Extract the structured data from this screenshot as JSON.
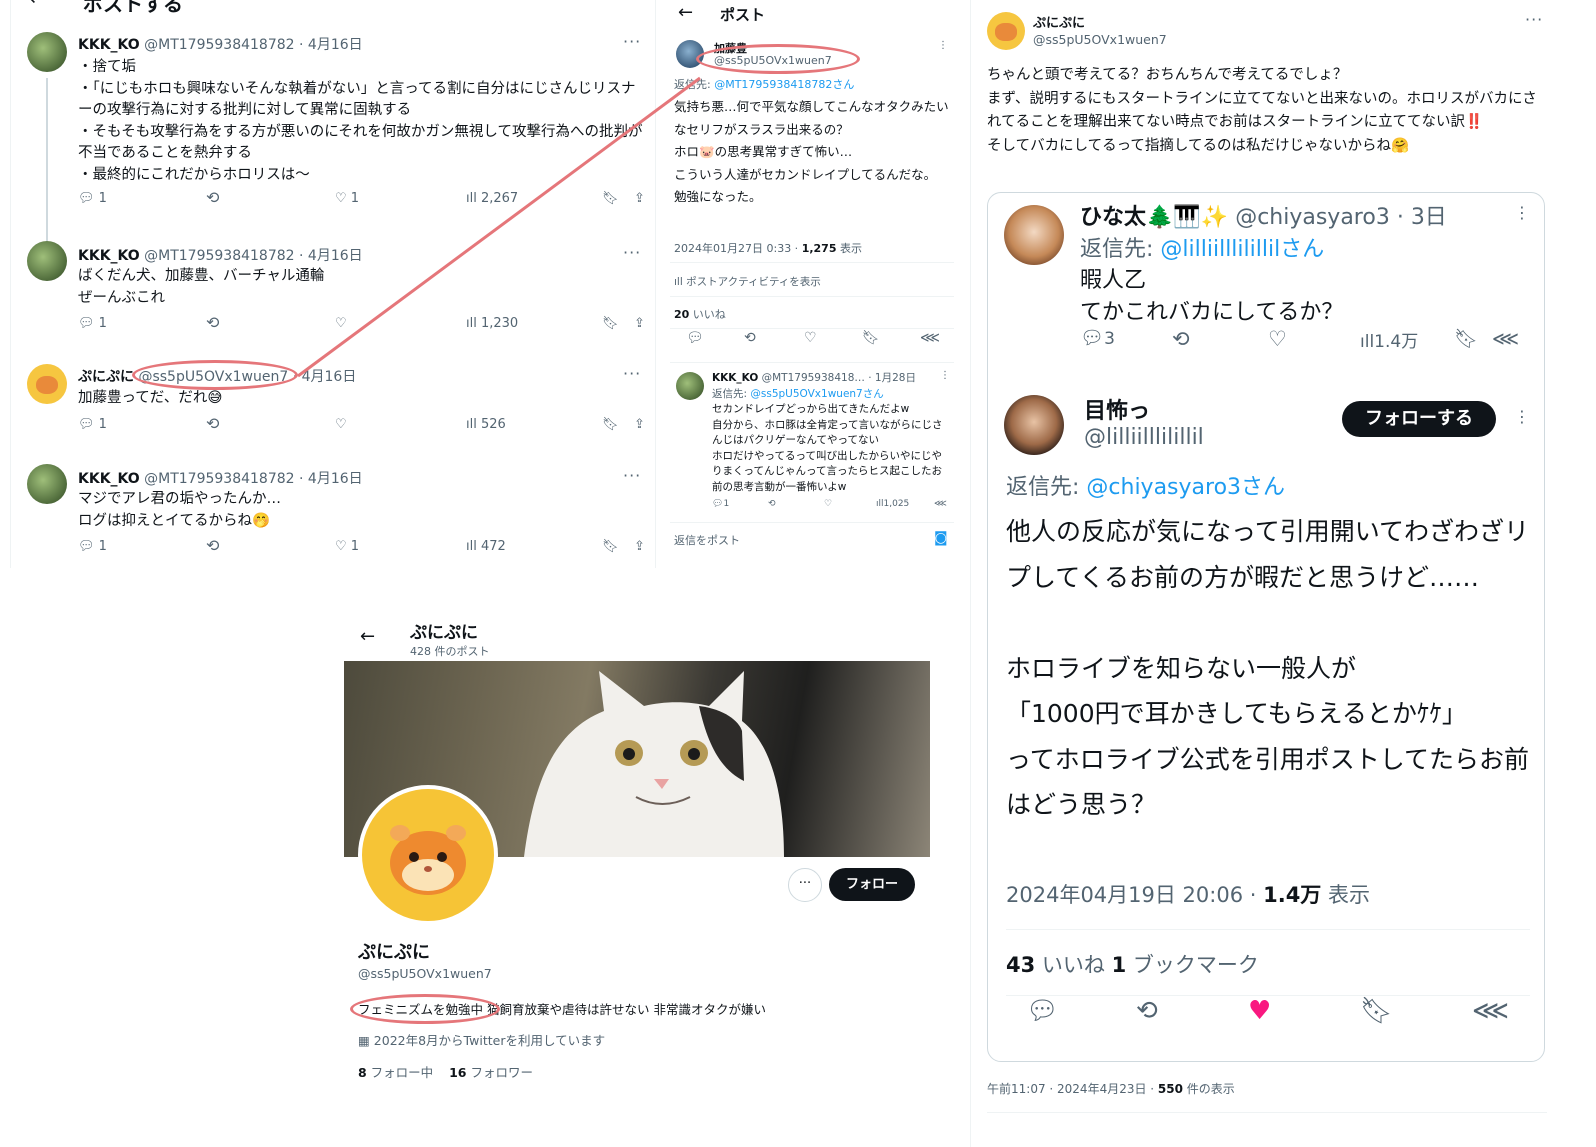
{
  "panel1": {
    "header_title": "ポストする",
    "posts": [
      {
        "name": "KKK_KO",
        "handle": "@MT1795938418782",
        "date": "· 4月16日",
        "text": "・捨て垢\n・「にじもホロも興味ないそんな執着がない」と言ってる割に自分はにじさんじリスナーの攻撃行為に対する批判に対して異常に固執する\n・そもそも攻撃行為をする方が悪いのにそれを何故かガン無視して攻撃行為への批判が不当であることを熱弁する\n・最終的にこれだからホロリスは～",
        "replies": "1",
        "retweets": "",
        "likes": "1",
        "views": "2,267"
      },
      {
        "name": "KKK_KO",
        "handle": "@MT1795938418782",
        "date": "· 4月16日",
        "text": "ばくだん犬、加藤豊、バーチャル通輪\nぜーんぶこれ",
        "replies": "1",
        "retweets": "",
        "likes": "",
        "views": "1,230"
      },
      {
        "name": "ぷにぷに",
        "handle": "@ss5pU5OVx1wuen7",
        "date": "· 4月16日",
        "text": "加藤豊ってだ、だれ😅",
        "replies": "1",
        "retweets": "",
        "likes": "",
        "views": "526"
      },
      {
        "name": "KKK_KO",
        "handle": "@MT1795938418782",
        "date": "· 4月16日",
        "text": "マジでアレ君の垢やったんか…\nログは抑えとイてるからね🤭",
        "replies": "1",
        "retweets": "",
        "likes": "1",
        "views": "472"
      }
    ]
  },
  "panel2": {
    "header_title": "ポスト",
    "author_name": "加藤豊",
    "author_handle": "@ss5pU5OVx1wuen7",
    "reply_to_prefix": "返信先: ",
    "reply_to_handle": "@MT1795938418782さん",
    "text": "気持ち悪…何で平気な顔してこんなオタクみたいなセリフがスラスラ出来るの？\nホロ🐷の思考異常すぎて怖い…\nこういう人達がセカンドレイプしてるんだな。\n勉強になった。",
    "timestamp": "2024年01月27日 0:33 · ",
    "views_count": "1,275",
    "views_label": " 表示",
    "activity": "ポストアクティビティを表示",
    "likes_count": "20",
    "likes_label": " いいね",
    "reply": {
      "name": "KKK_KO",
      "handle": "@MT1795938418…",
      "date": "· 1月28日",
      "reply_to_prefix": "返信先: ",
      "reply_to_handle": "@ss5pU5OVx1wuen7さん",
      "text": "セカンドレイプどっから出てきたんだよw\n自分から、ホロ豚は全肯定って言いながらにじさんじはパクリゲーなんてやってない\nホロだけやってるって叫び出したからいやにじやりまくってんじゃんって言ったらヒス起こしたお前の思考言動が一番怖いよw",
      "replies": "1",
      "views": "1,025"
    },
    "compose_placeholder": "返信をポスト"
  },
  "panel3": {
    "profile_name": "ぷにぷに",
    "posts_count": "428 件のポスト",
    "display_name": "ぷにぷに",
    "handle": "@ss5pU5OVx1wuen7",
    "bio": "フェミニズムを勉強中 猫飼育放棄や虐待は許せない 非常識オタクが嫌い",
    "joined": "2022年8月からTwitterを利用しています",
    "following_count": "8",
    "following_label": " フォロー中",
    "followers_count": "16",
    "followers_label": " フォロワー",
    "follow_button": "フォロー",
    "more_button": "···"
  },
  "panel4": {
    "name": "ぷにぷに",
    "handle": "@ss5pU5OVx1wuen7",
    "text": "ちゃんと頭で考えてる？おちんちんで考えてるでしょ？\nまず、説明するにもスタートラインに立ててないと出来ないの。ホロリスがバカにされてることを理解出来てない時点でお前はスタートラインに立ててない訳‼️\nそしてバカにしてるって指摘してるのは私だけじゃないからね🤗",
    "quote": {
      "first_name": "ひな太🌲🎹✨",
      "first_handle": "@chiyasyaro3",
      "first_date": "· 3日",
      "first_reply_prefix": "返信先: ",
      "first_reply_handle": "@lilliilllilillilさん",
      "first_text": "暇人乙\nてかこれバカにしてるか？",
      "first_replies": "3",
      "first_views": "1.4万",
      "second_name": "目怖っ",
      "second_handle": "@lilliilllilillil",
      "follow_button": "フォローする",
      "second_reply_prefix": "返信先: ",
      "second_reply_handle": "@chiyasyaro3さん",
      "second_text": "他人の反応が気になって引用開いてわざわざリプしてくるお前の方が暇だと思うけど……\n\nホロライブを知らない一般人が\n「1000円で耳かきしてもらえるとかｹｹ」\nってホロライブ公式を引用ポストしてたらお前はどう思う？",
      "timestamp": "2024年04月19日 20:06 · ",
      "views_count": "1.4万",
      "views_label": " 表示",
      "likes_count": "43",
      "likes_label": " いいね  ",
      "bookmarks_count": "1",
      "bookmarks_label": " ブックマーク"
    },
    "footer_time": "午前11:07 · 2024年4月23日 · ",
    "footer_views": "550",
    "footer_views_label": " 件の表示"
  },
  "colors": {
    "annotation": "#e5767a",
    "link": "#1d9bf0",
    "muted": "#536471",
    "liked": "#f91880"
  },
  "icons": [
    "back-arrow-icon",
    "more-dots-icon",
    "reply-icon",
    "retweet-icon",
    "like-icon",
    "views-icon",
    "bookmark-icon",
    "share-icon",
    "calendar-icon",
    "camera-icon"
  ]
}
